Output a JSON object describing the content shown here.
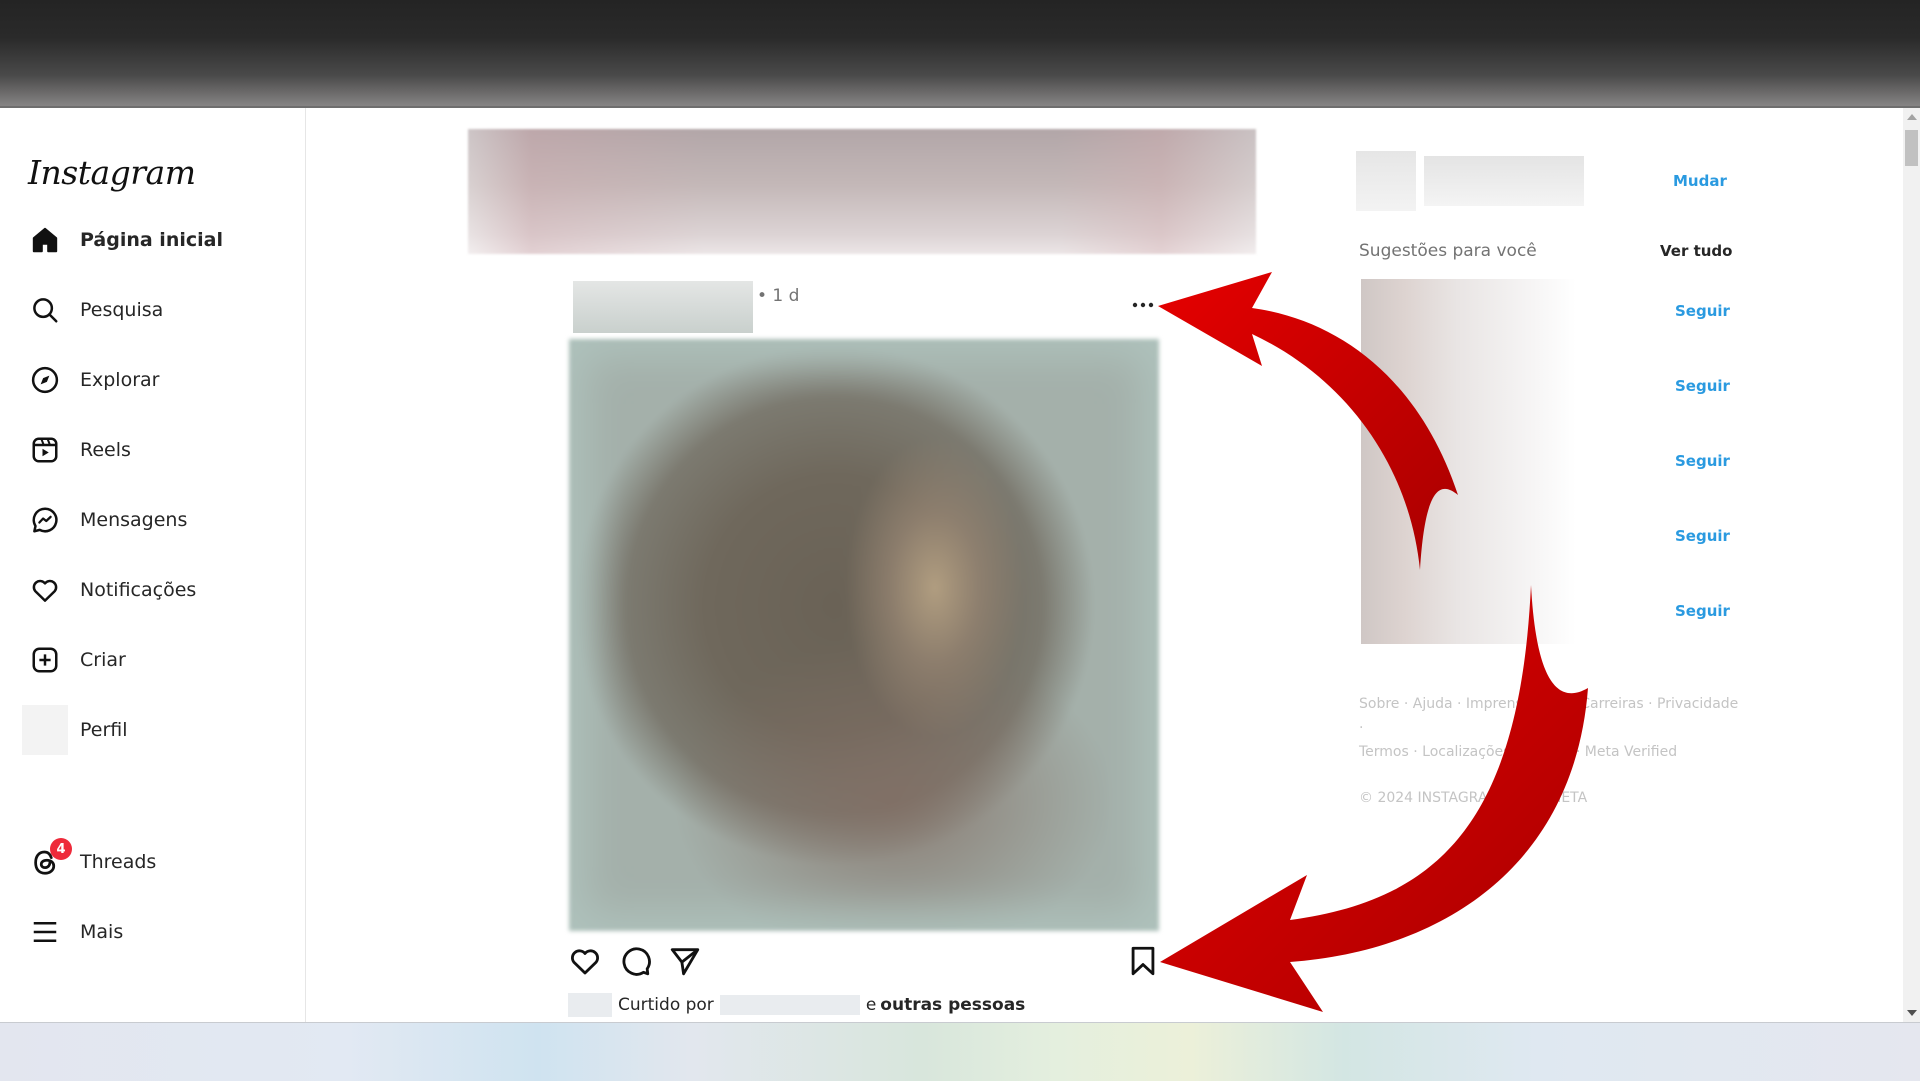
{
  "app": {
    "logo": "Instagram"
  },
  "sidebar": {
    "items": [
      {
        "label": "Página inicial",
        "icon": "home-icon",
        "active": true
      },
      {
        "label": "Pesquisa",
        "icon": "search-icon"
      },
      {
        "label": "Explorar",
        "icon": "compass-icon"
      },
      {
        "label": "Reels",
        "icon": "reels-icon"
      },
      {
        "label": "Mensagens",
        "icon": "messenger-icon"
      },
      {
        "label": "Notificações",
        "icon": "heart-icon"
      },
      {
        "label": "Criar",
        "icon": "plus-square-icon"
      },
      {
        "label": "Perfil",
        "icon": "avatar"
      }
    ],
    "bottom": [
      {
        "label": "Threads",
        "icon": "threads-icon",
        "badge": "4"
      },
      {
        "label": "Mais",
        "icon": "menu-icon"
      }
    ]
  },
  "post": {
    "time": "• 1 d",
    "more_icon": "more-horizontal-icon",
    "actions": [
      "heart-icon",
      "comment-icon",
      "share-icon",
      "bookmark-icon"
    ],
    "likes": {
      "prefix": "Curtido por",
      "connector": "e",
      "suffix": "outras pessoas"
    }
  },
  "right": {
    "switch_label": "Mudar",
    "suggestions_title": "Sugestões para você",
    "see_all": "Ver tudo",
    "follow_labels": [
      "Seguir",
      "Seguir",
      "Seguir",
      "Seguir",
      "Seguir"
    ],
    "footer_line1": "Sobre · Ajuda · Imprensa · API · Carreiras · Privacidade ·",
    "footer_line2": "Termos · Localizações · Idioma · Meta Verified",
    "copyright": "© 2024 INSTAGRAM FROM META"
  },
  "annotations": {
    "arrow_color": "#dd0000",
    "count": 2,
    "targets": [
      "more-options",
      "save-bookmark"
    ]
  },
  "colors": {
    "link_blue": "#2a9ae0",
    "badge_red": "#ee2a3a"
  }
}
